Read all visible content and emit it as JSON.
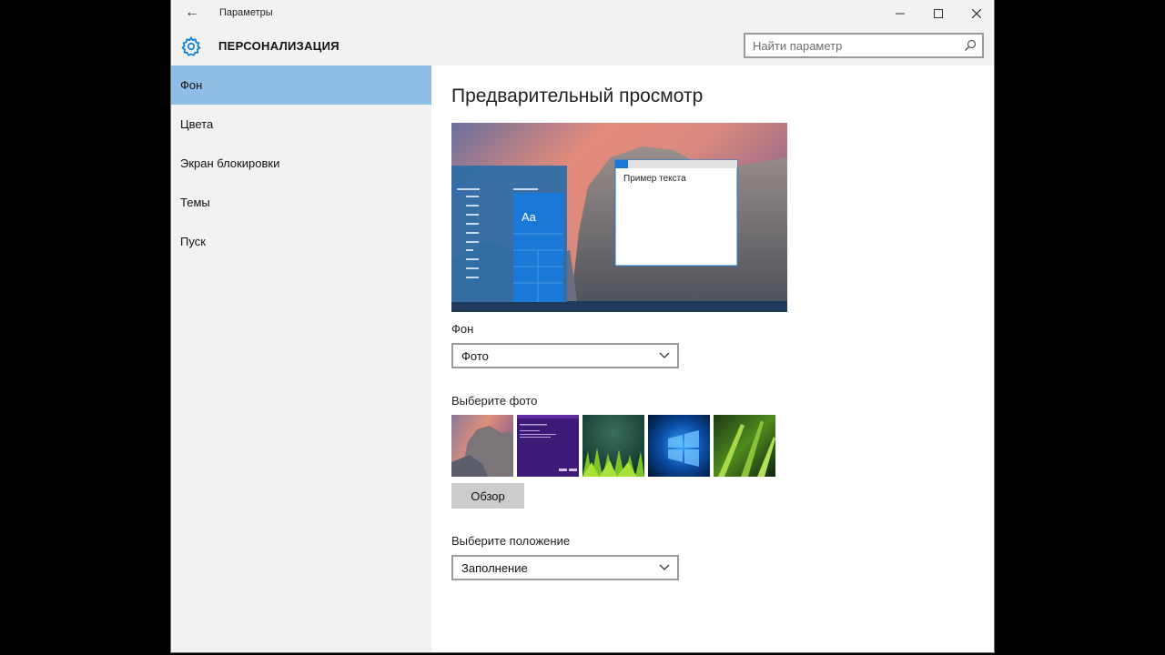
{
  "window": {
    "title": "Параметры",
    "section": "ПЕРСОНАЛИЗАЦИЯ",
    "search_placeholder": "Найти параметр"
  },
  "sidebar": {
    "items": [
      {
        "label": "Фон",
        "active": true
      },
      {
        "label": "Цвета"
      },
      {
        "label": "Экран блокировки"
      },
      {
        "label": "Темы"
      },
      {
        "label": "Пуск"
      }
    ]
  },
  "main": {
    "heading": "Предварительный просмотр",
    "preview_sample_text": "Пример текста",
    "preview_tile_text": "Aa",
    "background_label": "Фон",
    "background_value": "Фото",
    "choose_photo_label": "Выберите фото",
    "browse_button": "Обзор",
    "position_label": "Выберите положение",
    "position_value": "Заполнение"
  },
  "colors": {
    "accent": "#0078d7",
    "nav_active": "#8fbde6",
    "chrome": "#f2f2f2"
  }
}
